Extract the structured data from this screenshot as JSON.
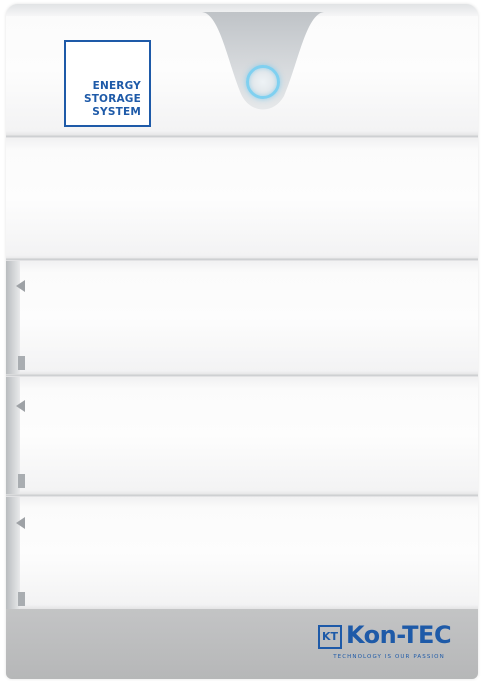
{
  "product": {
    "label_lines": [
      "ENERGY",
      "STORAGE",
      "SYSTEM"
    ],
    "power_indicator_icon": "power-ring-icon",
    "module_count": 4
  },
  "brand": {
    "mark": "KT",
    "name": "Kon-TEC",
    "tagline": "TECHNOLOGY IS OUR PASSION",
    "color": "#1e5aa8"
  },
  "colors": {
    "housing": "#fbfbfb",
    "base": "#b6b7b8",
    "indicator_glow": "#7fd0f0"
  }
}
